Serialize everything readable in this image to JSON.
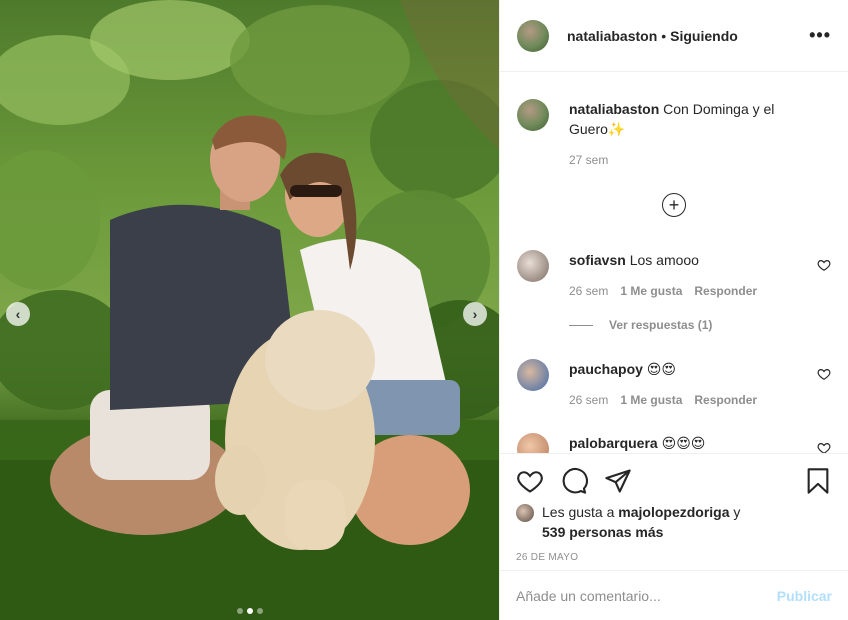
{
  "post": {
    "username": "nataliabaston",
    "follow_status": "Siguiendo",
    "more_icon": "more-horizontal-icon"
  },
  "caption": {
    "username": "nataliabaston",
    "text": "Con Dominga y el Guero✨",
    "age": "27 sem"
  },
  "comments": [
    {
      "username": "sofiavsn",
      "text": "Los amooo",
      "age": "26 sem",
      "likes": "1 Me gusta",
      "reply": "Responder",
      "avatar_color": "#c9bfb5"
    },
    {
      "username": "pauchapoy",
      "text": "😍😍",
      "age": "26 sem",
      "likes": "1 Me gusta",
      "reply": "Responder",
      "avatar_color": "#5a7fb0"
    },
    {
      "username": "palobarquera",
      "text": "😍😍😍",
      "avatar_color": "#d49a78"
    }
  ],
  "view_replies": "Ver respuestas (1)",
  "likes": {
    "prefix": "Les gusta a",
    "user": "majolopezdoriga",
    "middle": "y",
    "count": "539 personas más"
  },
  "date": "26 DE MAYO",
  "composer": {
    "placeholder": "Añade un comentario...",
    "publish": "Publicar"
  },
  "carousel": {
    "total": 3,
    "active": 1
  },
  "colors": {
    "link_disabled": "#b2dffc",
    "muted": "#8e8e8e",
    "text": "#262626"
  }
}
